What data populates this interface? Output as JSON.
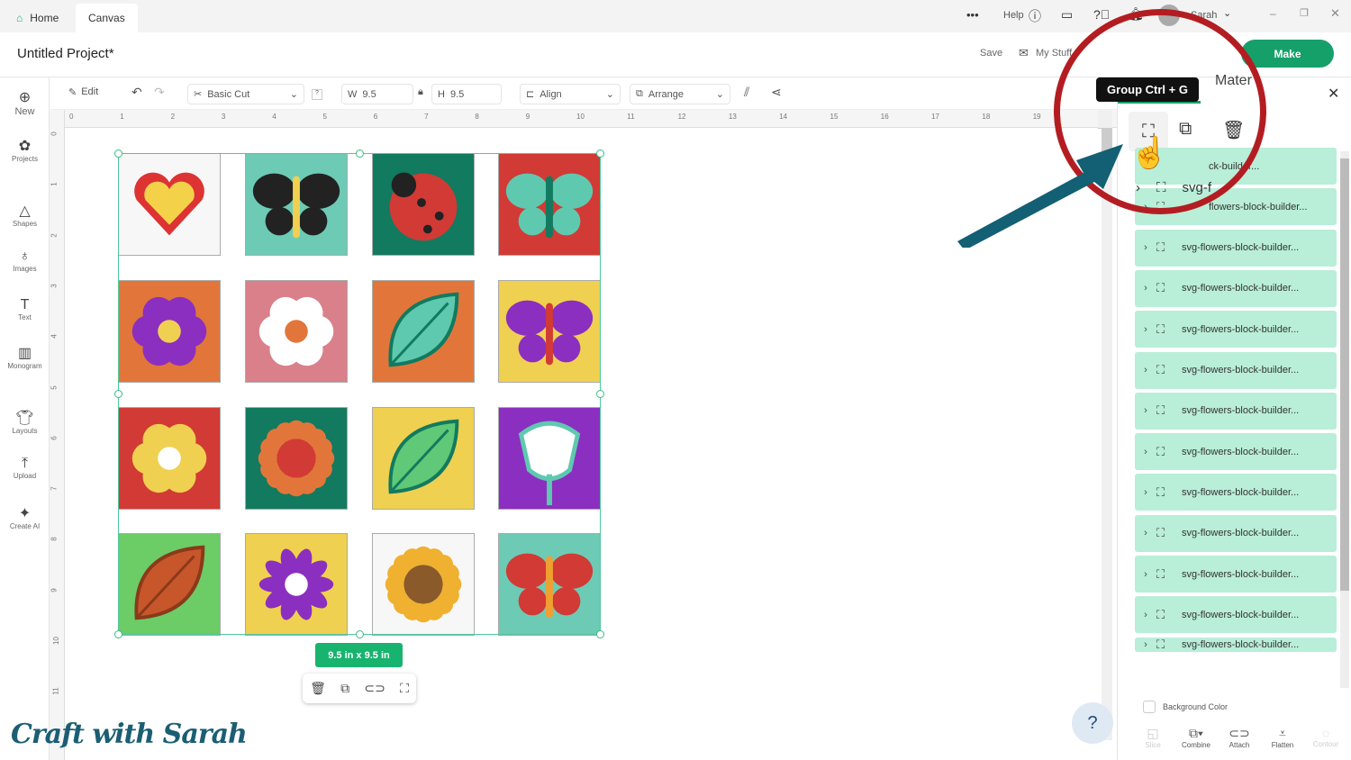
{
  "topbar": {
    "home": "Home",
    "canvas": "Canvas",
    "help": "Help",
    "user": "Sarah",
    "more": "•••"
  },
  "title": {
    "project": "Untitled Project*",
    "save": "Save",
    "my_stuff": "My Stuff",
    "make": "Make"
  },
  "left_tools": [
    {
      "label": "New",
      "icon": "plus-circle-icon"
    },
    {
      "label": "Projects",
      "icon": "projects-icon"
    },
    {
      "label": "Shapes",
      "icon": "shapes-icon"
    },
    {
      "label": "Images",
      "icon": "images-icon"
    },
    {
      "label": "Text",
      "icon": "text-icon"
    },
    {
      "label": "Monogram",
      "icon": "monogram-icon"
    },
    {
      "label": "Layouts",
      "icon": "layouts-icon"
    },
    {
      "label": "Upload",
      "icon": "upload-icon"
    },
    {
      "label": "Create AI",
      "icon": "sparkle-icon"
    }
  ],
  "toolbar": {
    "edit": "Edit",
    "operation": "Basic Cut",
    "w_label": "W",
    "w": "9.5",
    "h_label": "H",
    "h": "9.5",
    "align": "Align",
    "arrange": "Arrange"
  },
  "ruler_h": [
    "0",
    "1",
    "2",
    "3",
    "4",
    "5",
    "6",
    "7",
    "8",
    "9",
    "10",
    "11",
    "12",
    "13",
    "14",
    "15",
    "16",
    "17",
    "18",
    "19"
  ],
  "ruler_v": [
    "0",
    "1",
    "2",
    "3",
    "4",
    "5",
    "6",
    "7",
    "8",
    "9",
    "10",
    "11"
  ],
  "selection_size": "9.5  in x 9.5  in",
  "panel": {
    "tab_partial": "Mater",
    "tooltip": "Group Ctrl + G",
    "top_layer_partial": "ck-builder...",
    "expanded_label": "svg-f",
    "second_partial": "flowers-block-builder...",
    "layer_name": "svg-flowers-block-builder...",
    "background_color": "Background Color"
  },
  "bottom_tools": [
    {
      "label": "Slice"
    },
    {
      "label": "Combine"
    },
    {
      "label": "Attach"
    },
    {
      "label": "Flatten"
    },
    {
      "label": "Contour"
    }
  ],
  "watermark": "Craft with Sarah",
  "colors": {
    "accent": "#18b36e",
    "layer": "#b9eed8",
    "annotation_ring": "#b31d22",
    "arrow": "#135f73"
  }
}
